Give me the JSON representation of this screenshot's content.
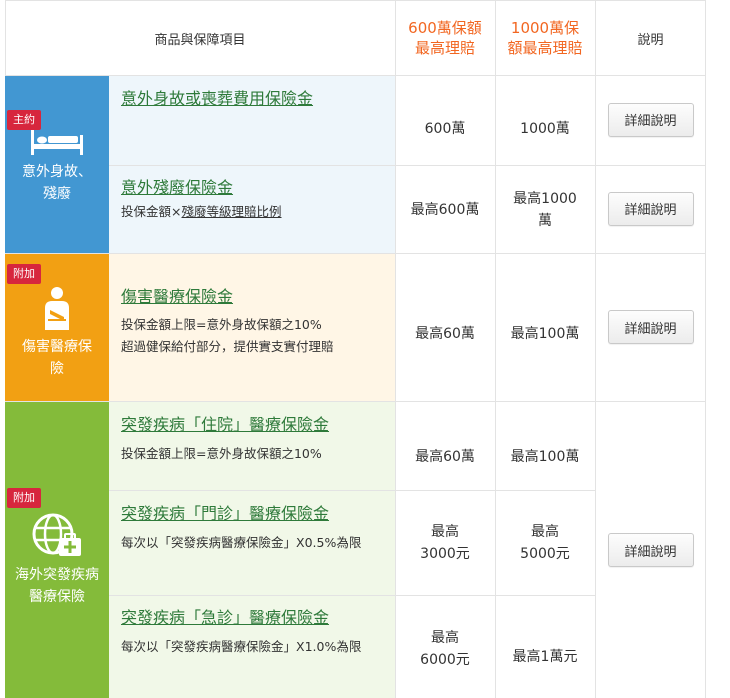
{
  "header": {
    "col_product": "商品與保障項目",
    "col_600": "600萬保額最高理賠",
    "col_1000": "1000萬保額最高理賠",
    "col_desc": "說明"
  },
  "colors": {
    "blue": "#4297d2",
    "orange": "#f2a013",
    "green": "#84bb3a",
    "tag_red": "#d7263d",
    "header_orange": "#f26722",
    "link_green": "#2e7a3a"
  },
  "sections": [
    {
      "tag": "主約",
      "icon": "bed-icon",
      "label": "意外身故、殘廢",
      "items": [
        {
          "title": "意外身故或喪葬費用保險金",
          "v600": "600萬",
          "v1000": "1000萬"
        },
        {
          "title": "意外殘廢保險金",
          "sub_prefix": "投保金額×",
          "sub_link": "殘廢等級理賠比例",
          "v600": "最高600萬",
          "v1000": "最高1000萬"
        }
      ]
    },
    {
      "tag": "附加",
      "icon": "injured-person-icon",
      "label": "傷害醫療保險",
      "items": [
        {
          "title": "傷害醫療保險金",
          "sub": "投保金額上限=意外身故保額之10%",
          "sub2": "超過健保給付部分，提供實支實付理賠",
          "v600": "最高60萬",
          "v1000": "最高100萬"
        }
      ]
    },
    {
      "tag": "附加",
      "icon": "globe-medkit-icon",
      "label": "海外突發疾病醫療保險",
      "items": [
        {
          "title": "突發疾病「住院」醫療保險金",
          "sub": "投保金額上限=意外身故保額之10%",
          "v600": "最高60萬",
          "v1000": "最高100萬"
        },
        {
          "title": "突發疾病「門診」醫療保險金",
          "sub": "每次以「突發疾病醫療保險金」X0.5%為限",
          "v600": "最高3000元",
          "v1000": "最高5000元"
        },
        {
          "title": "突發疾病「急診」醫療保險金",
          "sub": "每次以「突發疾病醫療保險金」X1.0%為限",
          "v600": "最高6000元",
          "v1000": "最高1萬元"
        }
      ]
    }
  ],
  "button_label": "詳細說明"
}
